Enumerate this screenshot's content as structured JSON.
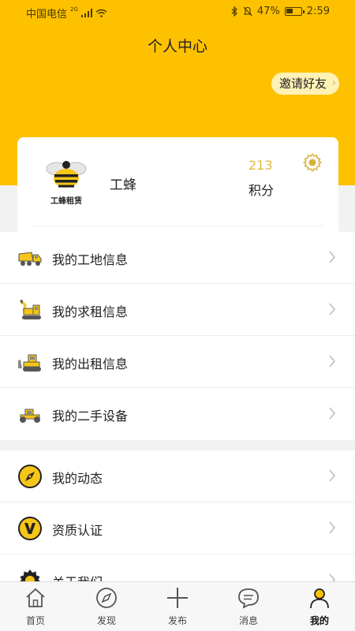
{
  "status_bar": {
    "carrier": "中国电信",
    "network": "2G",
    "battery_percent": "47%",
    "battery_level": 0.47,
    "time": "2:59"
  },
  "header": {
    "title": "个人中心",
    "invite_label": "邀请好友",
    "background_color": "#fec100"
  },
  "profile": {
    "logo_text": "工蜂租赁",
    "name": "工蜂",
    "points_value": "213",
    "points_label": "积分"
  },
  "menu_group_1": [
    {
      "label": "我的工地信息",
      "icon": "dump-truck-icon"
    },
    {
      "label": "我的求租信息",
      "icon": "excavator-icon"
    },
    {
      "label": "我的出租信息",
      "icon": "bulldozer-icon"
    },
    {
      "label": "我的二手设备",
      "icon": "road-roller-icon"
    }
  ],
  "menu_group_2": [
    {
      "label": "我的动态",
      "icon": "compass-icon"
    },
    {
      "label": "资质认证",
      "icon": "verified-v-icon"
    },
    {
      "label": "关于我们",
      "icon": "gear-icon"
    }
  ],
  "tabbar": [
    {
      "label": "首页",
      "icon": "home-icon"
    },
    {
      "label": "发现",
      "icon": "compass-icon"
    },
    {
      "label": "发布",
      "icon": "plus-icon"
    },
    {
      "label": "消息",
      "icon": "chat-icon"
    },
    {
      "label": "我的",
      "icon": "person-icon",
      "active": true
    }
  ],
  "colors": {
    "accent": "#fec100",
    "points": "#e3b93d",
    "icon_yellow": "#f5c518"
  }
}
